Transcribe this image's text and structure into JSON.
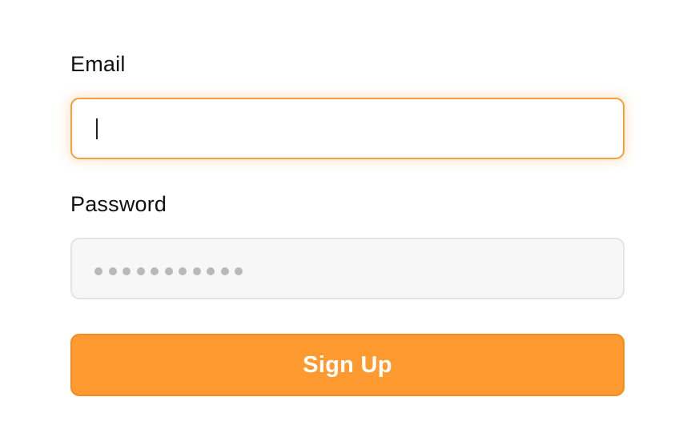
{
  "form": {
    "email": {
      "label": "Email",
      "value": "",
      "placeholder": ""
    },
    "password": {
      "label": "Password",
      "masked_length": 11
    },
    "submit_label": "Sign Up"
  },
  "colors": {
    "accent": "#ff9a30",
    "focus_border": "#f5a040",
    "input_disabled_bg": "#f7f7f7"
  }
}
